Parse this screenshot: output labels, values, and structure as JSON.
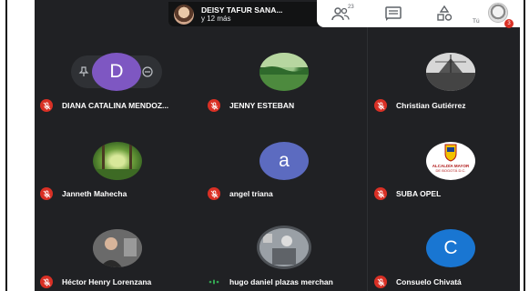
{
  "presenter": {
    "name": "DEISY TAFUR SANA...",
    "more": "y 12 más"
  },
  "toolbar": {
    "people_count": "23",
    "self_label": "Tú",
    "self_badge": "3",
    "icons": [
      "people-icon",
      "chat-icon",
      "activities-icon"
    ]
  },
  "participants": [
    {
      "name": "DIANA CATALINA MENDOZ...",
      "avatar_letter": "D",
      "muted": true,
      "avatar_color": "#7e57c2"
    },
    {
      "name": "JENNY ESTEBAN",
      "avatar_letter": "",
      "muted": true
    },
    {
      "name": "Christian Gutiérrez",
      "avatar_letter": "",
      "muted": true
    },
    {
      "name": "Janneth Mahecha",
      "avatar_letter": "",
      "muted": true
    },
    {
      "name": "angel triana",
      "avatar_letter": "a",
      "muted": true,
      "avatar_color": "#5c6bc0"
    },
    {
      "name": "SUBA OPEL",
      "avatar_letter": "",
      "muted": true,
      "avatar_text": "ALCALDÍA MAYOR DE BOGOTÁ D.C."
    },
    {
      "name": "Héctor Henry Lorenzana",
      "avatar_letter": "",
      "muted": true
    },
    {
      "name": "hugo daniel plazas merchan",
      "avatar_letter": "",
      "muted": false
    },
    {
      "name": "Consuelo Chivatá",
      "avatar_letter": "C",
      "muted": true,
      "avatar_color": "#1976d2"
    }
  ],
  "colors": {
    "background": "#202124",
    "muted_badge": "#d93025",
    "speaking": "#34a853"
  }
}
